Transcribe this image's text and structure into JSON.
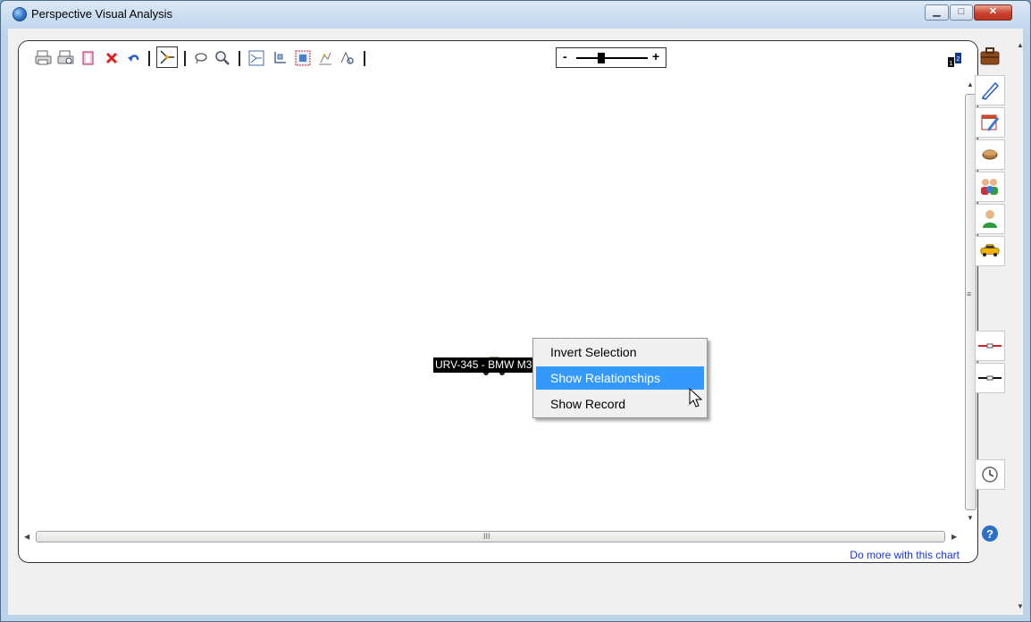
{
  "window": {
    "title": "Perspective Visual Analysis"
  },
  "toolbar": {
    "items": [
      "print-icon",
      "print-preview-icon",
      "copy-icon",
      "delete-icon",
      "undo-icon",
      "select-mode-icon",
      "lasso-icon",
      "zoom-to-selection-icon",
      "layout-icon",
      "arrange-icon",
      "select-all-icon",
      "analyze-icon",
      "find-icon"
    ],
    "zoom_minus": "-",
    "zoom_plus": "+",
    "zoom_level": 0.45
  },
  "chart": {
    "node_label": "URV-345 - BMW M3",
    "node_icon": "car-icon"
  },
  "context_menu": {
    "items": [
      {
        "label": "Invert Selection",
        "highlighted": false
      },
      {
        "label": "Show Relationships",
        "highlighted": true
      },
      {
        "label": "Show Record",
        "highlighted": false
      }
    ]
  },
  "footer": {
    "link": "Do more with this chart"
  },
  "scrollbar": {
    "grip": "III",
    "vgrip": "≡"
  },
  "sidebar": {
    "icons": [
      "briefcase-icon",
      "pencil-icon",
      "calendar-icon",
      "object-icon",
      "group-icon",
      "person-icon",
      "car-icon",
      "red-link-icon",
      "black-link-icon",
      "clock-icon",
      "help-icon"
    ]
  },
  "colors": {
    "highlight": "#3399ff",
    "link": "#1a34d9",
    "delete": "#e02020"
  }
}
